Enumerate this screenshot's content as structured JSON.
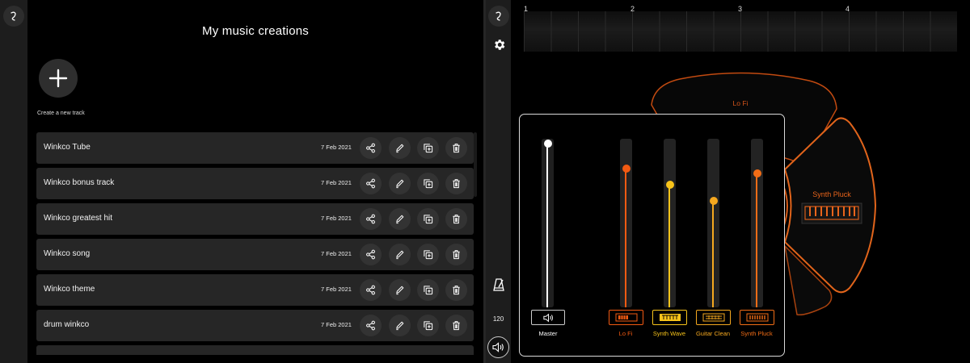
{
  "library": {
    "title": "My music creations",
    "add_label": "Create a new track",
    "tracks": [
      {
        "name": "Winkco Tube",
        "date": "7 Feb 2021"
      },
      {
        "name": "Winkco bonus track",
        "date": "7 Feb 2021"
      },
      {
        "name": "Winkco greatest hit",
        "date": "7 Feb 2021"
      },
      {
        "name": "Winkco song",
        "date": "7 Feb 2021"
      },
      {
        "name": "Winkco theme",
        "date": "7 Feb 2021"
      },
      {
        "name": "drum winkco",
        "date": "7 Feb 2021"
      },
      {
        "name": "",
        "date": ""
      }
    ],
    "row_icons": [
      "share-icon",
      "edit-icon",
      "duplicate-icon",
      "delete-icon"
    ]
  },
  "editor": {
    "timeline_bars": [
      "1",
      "2",
      "3",
      "4"
    ],
    "tempo": "120",
    "rail_icons": [
      "logo-icon",
      "gear-icon",
      "metronome-icon",
      "speaker-icon"
    ],
    "wheel_segments": [
      {
        "label": "Lo Fi"
      },
      {
        "label": "Synth Pluck"
      }
    ],
    "mixer": {
      "master": {
        "label": "Master",
        "level": 1.0
      },
      "channels": [
        {
          "label": "Lo Fi",
          "level": 0.84,
          "color": "#f25a12"
        },
        {
          "label": "Synth Wave",
          "level": 0.74,
          "color": "#f7c31a"
        },
        {
          "label": "Guitar Clean",
          "level": 0.64,
          "color": "#f5a81f"
        },
        {
          "label": "Synth Pluck",
          "level": 0.81,
          "color": "#f26d16"
        }
      ]
    }
  },
  "colors": {
    "accent_orange": "#e8641b",
    "accent_yellow": "#f5c218",
    "row_bg": "#262626",
    "rail_bg": "#1d1d1d"
  }
}
